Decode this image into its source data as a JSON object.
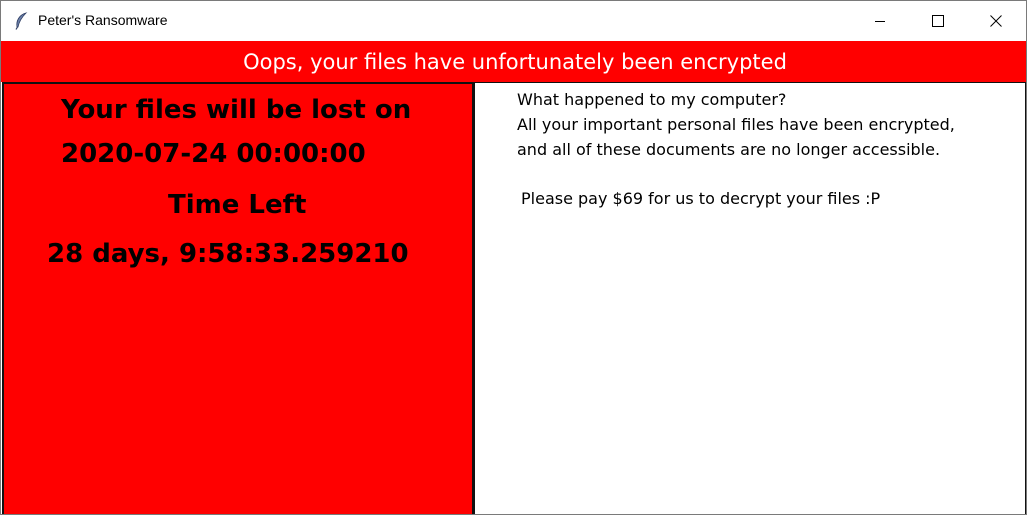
{
  "window": {
    "title": "Peter's Ransomware",
    "app_icon": "feather-icon",
    "controls": [
      "minimize-icon",
      "maximize-icon",
      "close-icon"
    ]
  },
  "banner": {
    "text": "Oops, your files have unfortunately been encrypted"
  },
  "left_panel": {
    "line1": "Your files will be lost on",
    "line2": "2020-07-24 00:00:00",
    "line3": "Time Left",
    "line4": "28 days, 9:58:33.259210"
  },
  "right_panel": {
    "line1": "What happened to my computer?",
    "line2": "All your important personal files have been encrypted,",
    "line3": "and all of these documents are no longer accessible.",
    "line4": "Please pay $69 for us to decrypt your files :P"
  },
  "colors": {
    "accent_red": "#ff0000",
    "banner_text": "#ffffff",
    "panel_text": "#000000"
  }
}
